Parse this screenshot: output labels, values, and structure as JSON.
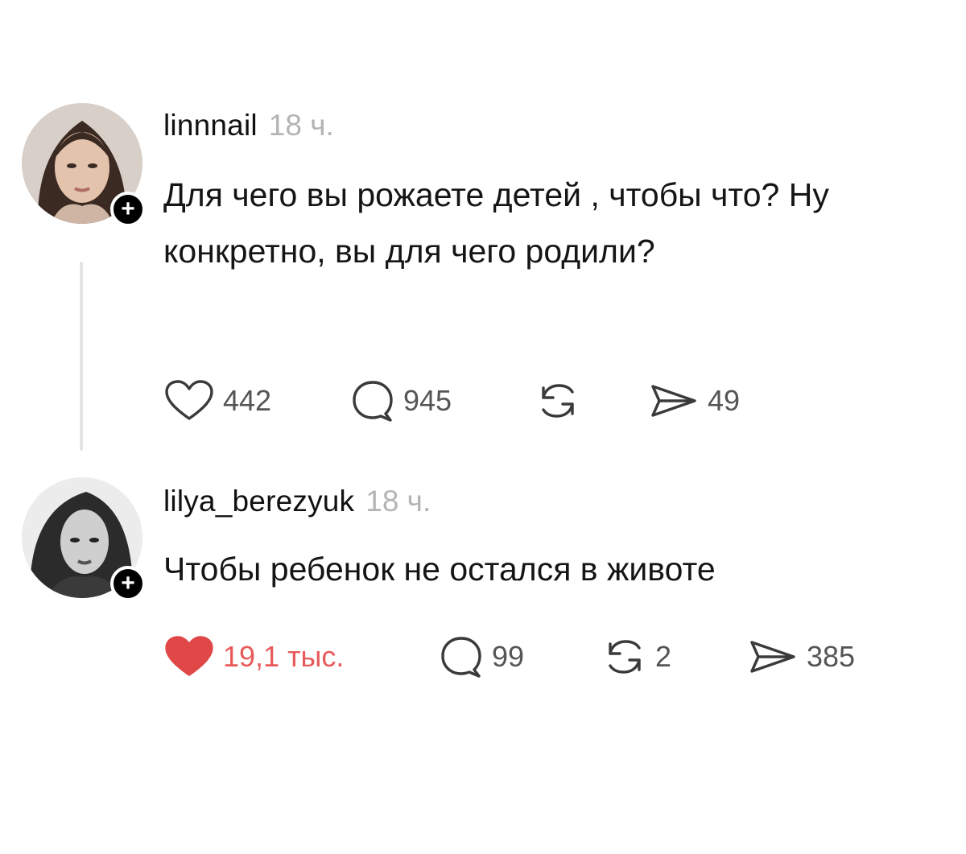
{
  "posts": [
    {
      "username": "linnnail",
      "time": "18 ч.",
      "text": "Для чего вы рожаете детей , чтобы что? Ну конкретно, вы для чего родили?",
      "likes": "442",
      "comments": "945",
      "reposts": "",
      "shares": "49",
      "liked": false
    },
    {
      "username": "lilya_berezyuk",
      "time": "18 ч.",
      "text": "Чтобы ребенок не остался в животе",
      "likes": "19,1 тыс.",
      "comments": "99",
      "reposts": "2",
      "shares": "385",
      "liked": true
    }
  ],
  "icons": {
    "like": "heart-icon",
    "comment": "speech-bubble-icon",
    "repost": "repost-arrows-icon",
    "share": "paper-plane-icon",
    "follow": "plus-icon"
  },
  "follow_symbol": "+",
  "colors": {
    "like_active": "#e04848",
    "icon_stroke": "#3a3a3a",
    "muted_text": "#b4b4b4",
    "thread_line": "#e4e4e4",
    "badge": "#000000"
  }
}
